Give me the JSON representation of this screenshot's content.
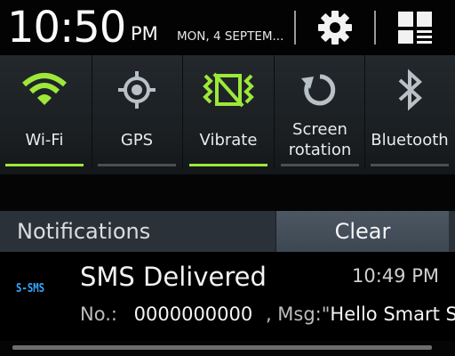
{
  "status": {
    "time": "10:50",
    "ampm": "PM",
    "date": "MON, 4 SEPTEM..."
  },
  "header_buttons": [
    {
      "name": "settings",
      "icon": "gear-icon"
    },
    {
      "name": "notification-panel-toggle",
      "icon": "grid-icon"
    }
  ],
  "quick_settings": [
    {
      "label": "Wi-Fi",
      "icon": "wifi-icon",
      "on": true
    },
    {
      "label": "GPS",
      "icon": "gps-icon",
      "on": false
    },
    {
      "label": "Vibrate",
      "icon": "vibrate-icon",
      "on": true
    },
    {
      "label_line1": "Screen",
      "label_line2": "rotation",
      "icon": "rotation-icon",
      "on": false
    },
    {
      "label": "Bluetooth",
      "icon": "bluetooth-icon",
      "on": false
    }
  ],
  "colors": {
    "active": "#9de83a",
    "inactive_icon": "#b9c0c6",
    "logo": "#36a6ff"
  },
  "notifications": {
    "title": "Notifications",
    "clear_label": "Clear",
    "items": [
      {
        "app_logo": "S-SMS",
        "title": "SMS Delivered",
        "time": "10:49 PM",
        "no_label": "No.:",
        "number": "0000000000",
        "msg_label": ", Msg:\"",
        "msg": "Hello Smart SM"
      }
    ]
  }
}
